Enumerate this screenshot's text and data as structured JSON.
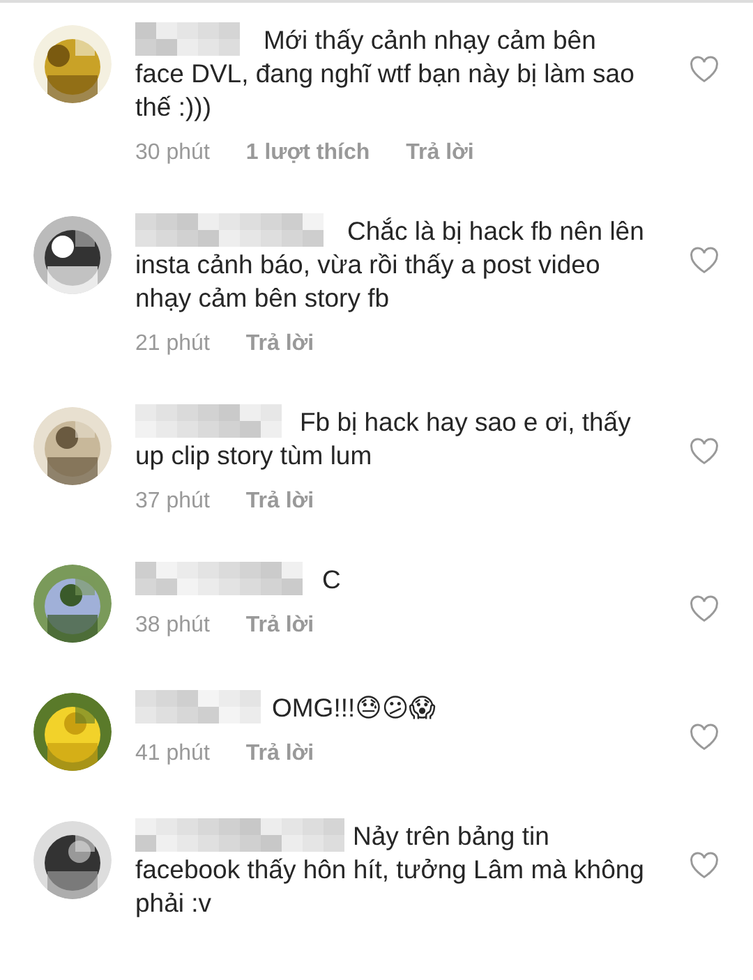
{
  "comments": [
    {
      "text": "Mới thấy cảnh nhạy cảm bên face DVL, đang nghĩ wtf bạn này bị làm sao thế :)))",
      "time": "30 phút",
      "likes": "1 lượt thích",
      "reply": "Trả lời"
    },
    {
      "text": "Chắc là bị hack fb nên lên insta cảnh báo, vừa rồi thấy a post video nhạy cảm bên story fb",
      "time": "21 phút",
      "reply": "Trả lời"
    },
    {
      "text": "Fb bị hack hay sao e ơi, thấy up clip story tùm lum",
      "time": "37 phút",
      "reply": "Trả lời"
    },
    {
      "text": "C",
      "time": "38 phút",
      "reply": "Trả lời"
    },
    {
      "text": "OMG!!!😓😕😱",
      "time": "41 phút",
      "reply": "Trả lời"
    },
    {
      "text": "Nảy trên bảng tin facebook thấy hôn hít, tưởng Lâm mà không phải :v"
    }
  ]
}
